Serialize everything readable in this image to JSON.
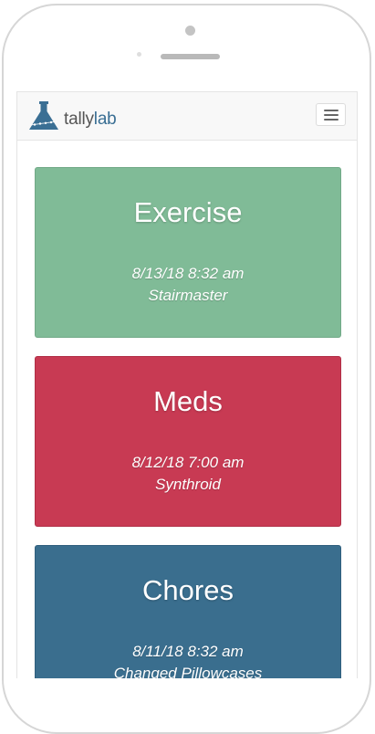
{
  "app": {
    "brand_prefix": "tally",
    "brand_suffix": "lab",
    "logo_icon": "flask-icon",
    "menu_icon": "hamburger-menu-icon"
  },
  "colors": {
    "exercise": "#80bb97",
    "meds": "#c83a53",
    "chores": "#3a6e8e",
    "brand_accent": "#3a6f94"
  },
  "cards": [
    {
      "title": "Exercise",
      "timestamp": "8/13/18 8:32 am",
      "note": "Stairmaster"
    },
    {
      "title": "Meds",
      "timestamp": "8/12/18 7:00 am",
      "note": "Synthroid"
    },
    {
      "title": "Chores",
      "timestamp": "8/11/18 8:32 am",
      "note": "Changed Pillowcases"
    }
  ]
}
